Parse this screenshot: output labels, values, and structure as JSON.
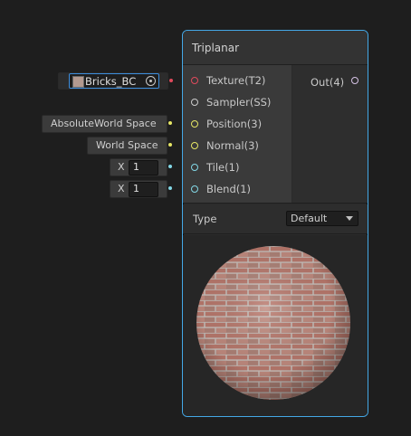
{
  "node": {
    "title": "Triplanar",
    "inputs": [
      {
        "label": "Texture(T2)"
      },
      {
        "label": "Sampler(SS)"
      },
      {
        "label": "Position(3)"
      },
      {
        "label": "Normal(3)"
      },
      {
        "label": "Tile(1)"
      },
      {
        "label": "Blend(1)"
      }
    ],
    "output": {
      "label": "Out(4)"
    },
    "type_label": "Type",
    "type_value": "Default"
  },
  "fields": {
    "texture_value": "Bricks_BC",
    "position_value": "AbsoluteWorld Space",
    "normal_value": "World Space",
    "tile_axis": "X",
    "tile_value": "1",
    "blend_axis": "X",
    "blend_value": "1"
  },
  "colors": {
    "node_border": "#44a8e6",
    "port_texture": "#e04a5c",
    "port_vector3": "#e6e665",
    "port_float": "#83d8e6",
    "port_sampler": "#cccccc",
    "port_out": "#d6c3e6"
  },
  "icons": {
    "texture_swatch": "texture-thumbnail-icon",
    "object_picker": "object-picker-icon",
    "dropdown": "chevron-down-icon"
  }
}
